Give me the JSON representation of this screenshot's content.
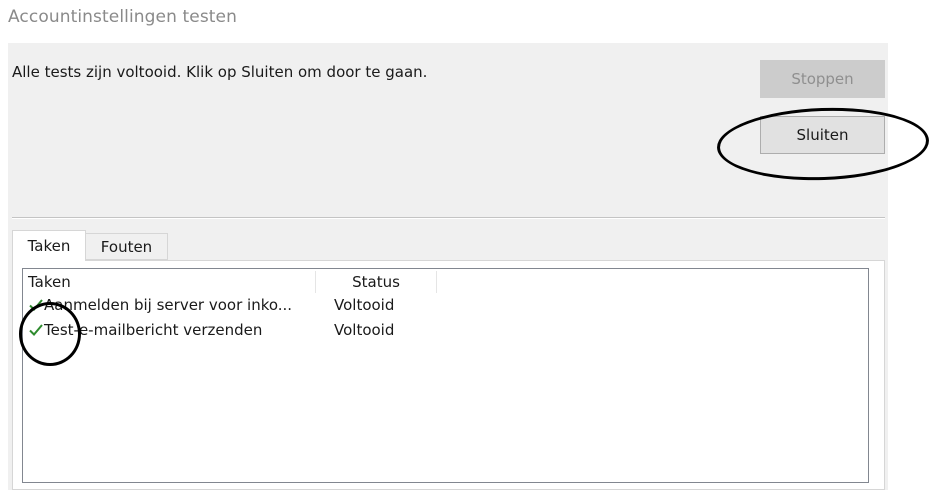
{
  "window": {
    "title": "Accountinstellingen testen"
  },
  "message": "Alle tests zijn voltooid. Klik op Sluiten om door te gaan.",
  "buttons": {
    "stop_label": "Stoppen",
    "close_label": "Sluiten"
  },
  "tabs": [
    {
      "label": "Taken",
      "active": true
    },
    {
      "label": "Fouten",
      "active": false
    }
  ],
  "table": {
    "columns": [
      "Taken",
      "Status"
    ],
    "rows": [
      {
        "task": "Aanmelden bij server voor inko...",
        "status": "Voltooid",
        "icon": "checkmark-icon"
      },
      {
        "task": "Test-e-mailbericht verzenden",
        "status": "Voltooid",
        "icon": "checkmark-icon"
      }
    ]
  },
  "colors": {
    "check": "#2e8b2e",
    "annotation": "#000000"
  }
}
